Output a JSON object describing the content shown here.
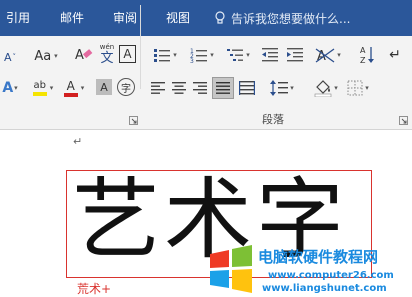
{
  "menubar": {
    "tabs": [
      {
        "label": "引用"
      },
      {
        "label": "邮件"
      },
      {
        "label": "审阅"
      },
      {
        "label": "视图"
      }
    ],
    "tell_me": "告诉我您想要做什么..."
  },
  "ribbon": {
    "font_size_shrink": "A",
    "change_case": "Aa",
    "phonetic_top": "wén",
    "phonetic_char": "文",
    "char_border": "A",
    "text_effects": "A",
    "highlight": "ab",
    "font_color": "A",
    "char_shading": "A",
    "enclose_char": "字",
    "sort": "A↓Z",
    "paragraph_group_label": "段落",
    "colors": {
      "highlight_yellow": "#f5e400",
      "font_color_red": "#d21f1f"
    }
  },
  "document": {
    "paragraph_mark": "↵",
    "wordart_text": "艺术字",
    "cursor_text": "荒术+"
  },
  "watermark": {
    "title": "电脑软硬件教程网",
    "url1": "www.computer26.com",
    "url2": "www.liangshunet.com"
  }
}
